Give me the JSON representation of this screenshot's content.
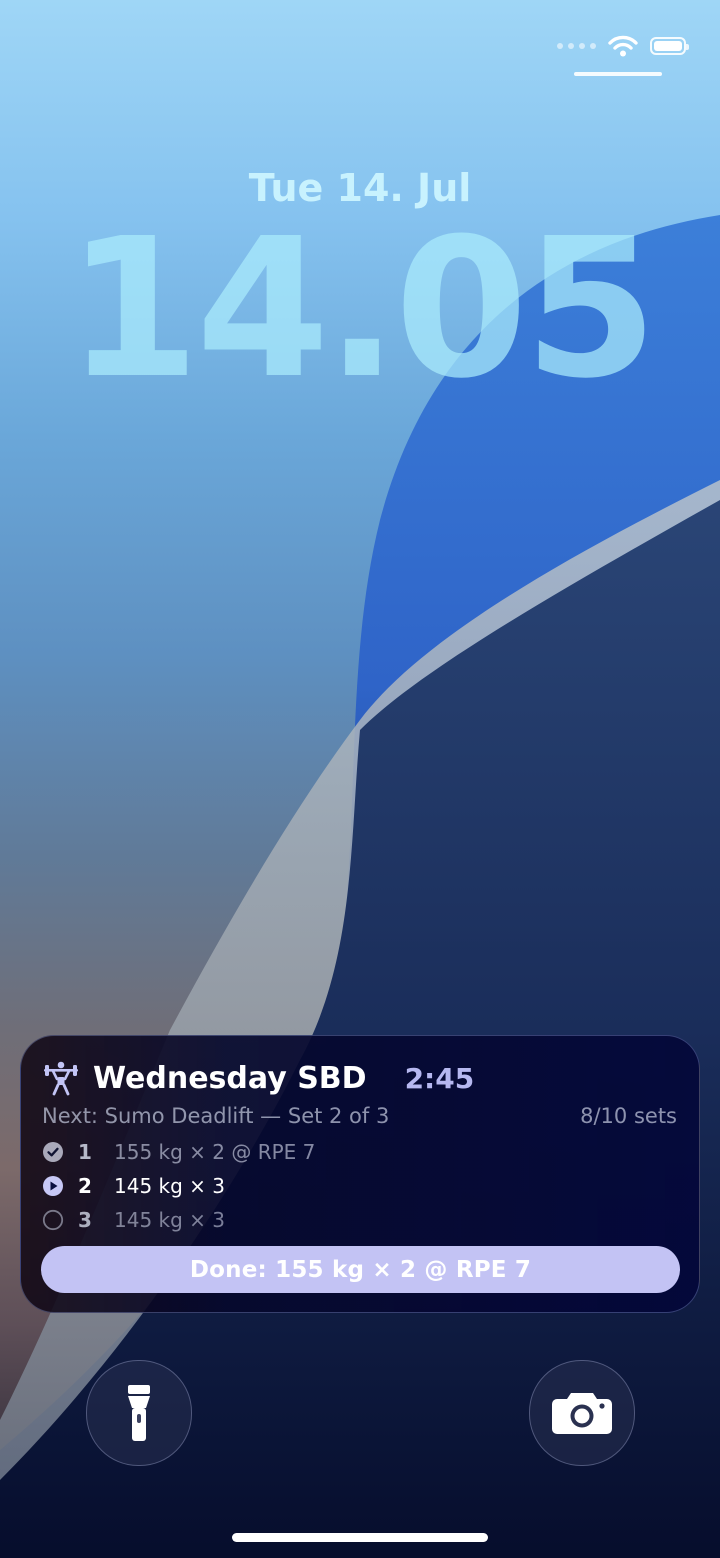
{
  "status_bar": {
    "signal_icon": "cellular-dots-icon",
    "wifi_icon": "wifi-icon",
    "battery_icon": "battery-full-icon"
  },
  "lock_screen": {
    "date": "Tue 14. Jul",
    "time": "14.05"
  },
  "live_activity": {
    "icon": "weightlifter-icon",
    "workout_title": "Wednesday SBD",
    "timer": "2:45",
    "next_label": "Next: Sumo Deadlift — Set 2 of 3",
    "progress": "8/10 sets",
    "sets": [
      {
        "number": "1",
        "detail": "155 kg × 2 @ RPE 7",
        "status": "completed",
        "icon": "checkmark-circle-icon"
      },
      {
        "number": "2",
        "detail": "145 kg × 3",
        "status": "current",
        "icon": "play-circle-icon"
      },
      {
        "number": "3",
        "detail": "145 kg × 3",
        "status": "pending",
        "icon": "empty-circle-icon"
      }
    ],
    "done_button_label": "Done: 155 kg × 2 @ RPE 7",
    "colors": {
      "accent": "#b6b8f0",
      "button": "#c3c3f4"
    }
  },
  "quick_actions": {
    "flashlight_icon": "flashlight-icon",
    "camera_icon": "camera-icon"
  }
}
